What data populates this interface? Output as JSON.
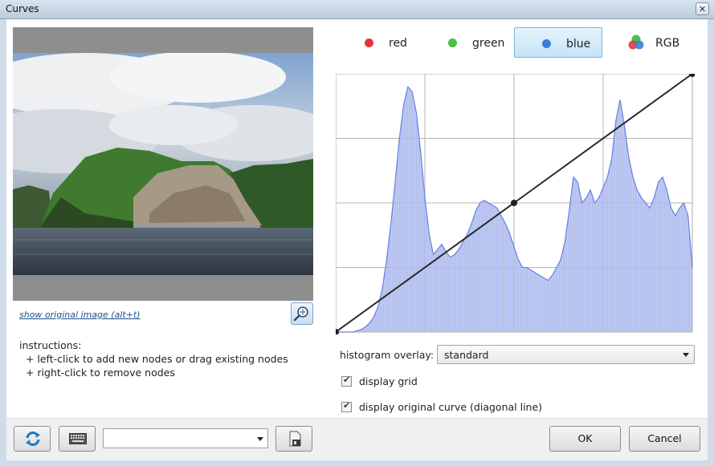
{
  "window": {
    "title": "Curves",
    "close_symbol": "✕"
  },
  "preview": {
    "show_original_link": "show original image (alt+t)"
  },
  "instructions": {
    "heading": "instructions:",
    "line1": "  + left-click to add new nodes or drag existing nodes",
    "line2": "  + right-click to remove nodes"
  },
  "channels": [
    {
      "label": "red",
      "color": "#e0353a",
      "active": false
    },
    {
      "label": "green",
      "color": "#44c44a",
      "active": false
    },
    {
      "label": "blue",
      "color": "#3a7fd5",
      "active": true
    },
    {
      "label": "RGB",
      "colors": [
        "#e0353a",
        "#44c44a",
        "#3a7fd5"
      ],
      "active": false
    }
  ],
  "curve": {
    "nodes": [
      [
        0,
        0
      ],
      [
        0.5,
        0.5
      ],
      [
        1,
        1
      ]
    ]
  },
  "histogram": {
    "fill_color": "#b7c4f0",
    "line_color": "#6a7fe0",
    "values": [
      0,
      0,
      0,
      0,
      0,
      0.005,
      0.01,
      0.02,
      0.035,
      0.06,
      0.1,
      0.17,
      0.28,
      0.42,
      0.58,
      0.75,
      0.88,
      0.95,
      0.93,
      0.85,
      0.7,
      0.52,
      0.38,
      0.3,
      0.32,
      0.34,
      0.31,
      0.29,
      0.3,
      0.32,
      0.35,
      0.38,
      0.42,
      0.47,
      0.5,
      0.51,
      0.5,
      0.49,
      0.48,
      0.45,
      0.42,
      0.38,
      0.33,
      0.28,
      0.25,
      0.25,
      0.24,
      0.23,
      0.22,
      0.21,
      0.2,
      0.22,
      0.25,
      0.28,
      0.35,
      0.47,
      0.6,
      0.58,
      0.5,
      0.52,
      0.55,
      0.5,
      0.52,
      0.56,
      0.6,
      0.67,
      0.82,
      0.9,
      0.8,
      0.68,
      0.6,
      0.55,
      0.52,
      0.5,
      0.48,
      0.52,
      0.58,
      0.6,
      0.55,
      0.48,
      0.45,
      0.48,
      0.5,
      0.45,
      0.25
    ]
  },
  "overlay": {
    "label": "histogram overlay:",
    "selected": "standard"
  },
  "options": {
    "display_grid": {
      "label": "display grid",
      "checked": true
    },
    "display_original_curve": {
      "label": "display original curve (diagonal line)",
      "checked": true
    }
  },
  "buttons": {
    "ok": "OK",
    "cancel": "Cancel"
  },
  "preset_combo": {
    "value": ""
  },
  "icons": {
    "refresh": "refresh-icon",
    "zoom": "zoom-icon",
    "keyboard": "keyboard-icon",
    "save": "save-icon"
  }
}
